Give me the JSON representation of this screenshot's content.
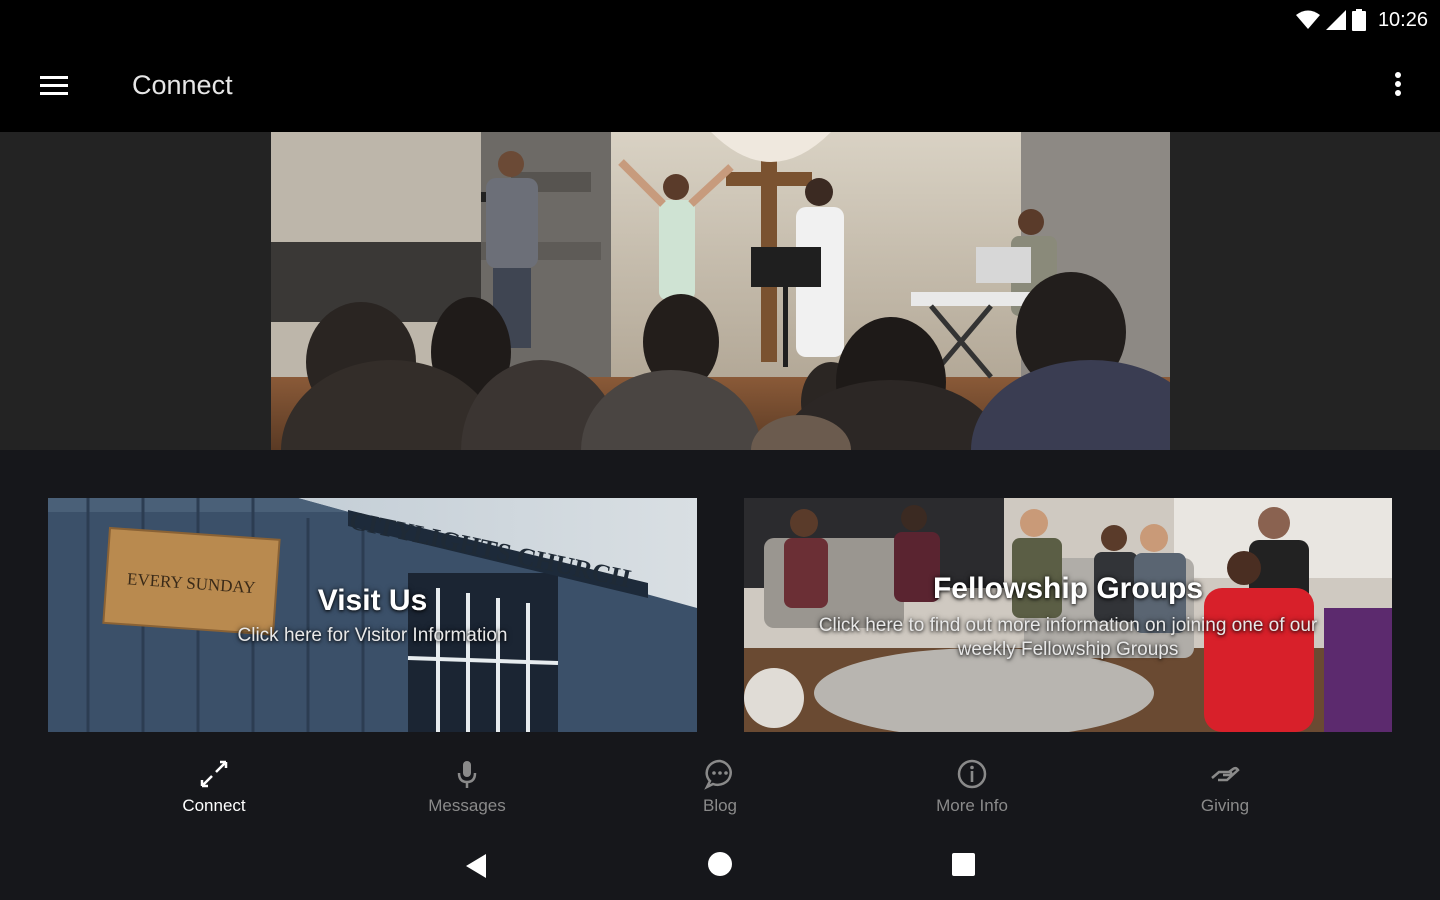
{
  "status_bar": {
    "time": "10:26",
    "icons": [
      "wifi-icon",
      "cell-signal-icon",
      "battery-icon"
    ]
  },
  "app_bar": {
    "title": "Connect",
    "menu_icon": "hamburger-menu-icon",
    "overflow_icon": "more-vert-icon"
  },
  "hero": {
    "image": "church-worship-band-photo"
  },
  "cards": [
    {
      "title": "Visit Us",
      "subtitle": "Click here for Visitor Information",
      "image": "citylights-church-building-photo",
      "sign_text": "EVERY SUNDAY",
      "building_text": "CITYLIGHTS CHURCH"
    },
    {
      "title": "Fellowship Groups",
      "subtitle_line1": "Click here to find out more information on joining one of our",
      "subtitle_line2": "weekly Fellowship Groups",
      "image": "fellowship-group-living-room-photo"
    }
  ],
  "bottom_nav": [
    {
      "label": "Connect",
      "icon": "connect-arrows-icon",
      "active": true
    },
    {
      "label": "Messages",
      "icon": "microphone-icon",
      "active": false
    },
    {
      "label": "Blog",
      "icon": "chat-bubble-icon",
      "active": false
    },
    {
      "label": "More Info",
      "icon": "info-icon",
      "active": false
    },
    {
      "label": "Giving",
      "icon": "giving-hand-icon",
      "active": false
    }
  ],
  "system_nav": [
    "back-icon",
    "home-icon",
    "recents-icon"
  ],
  "colors": {
    "background": "#16171b",
    "app_bar": "#000000",
    "active_nav": "#ffffff",
    "inactive_nav": "#8a8a8a"
  }
}
